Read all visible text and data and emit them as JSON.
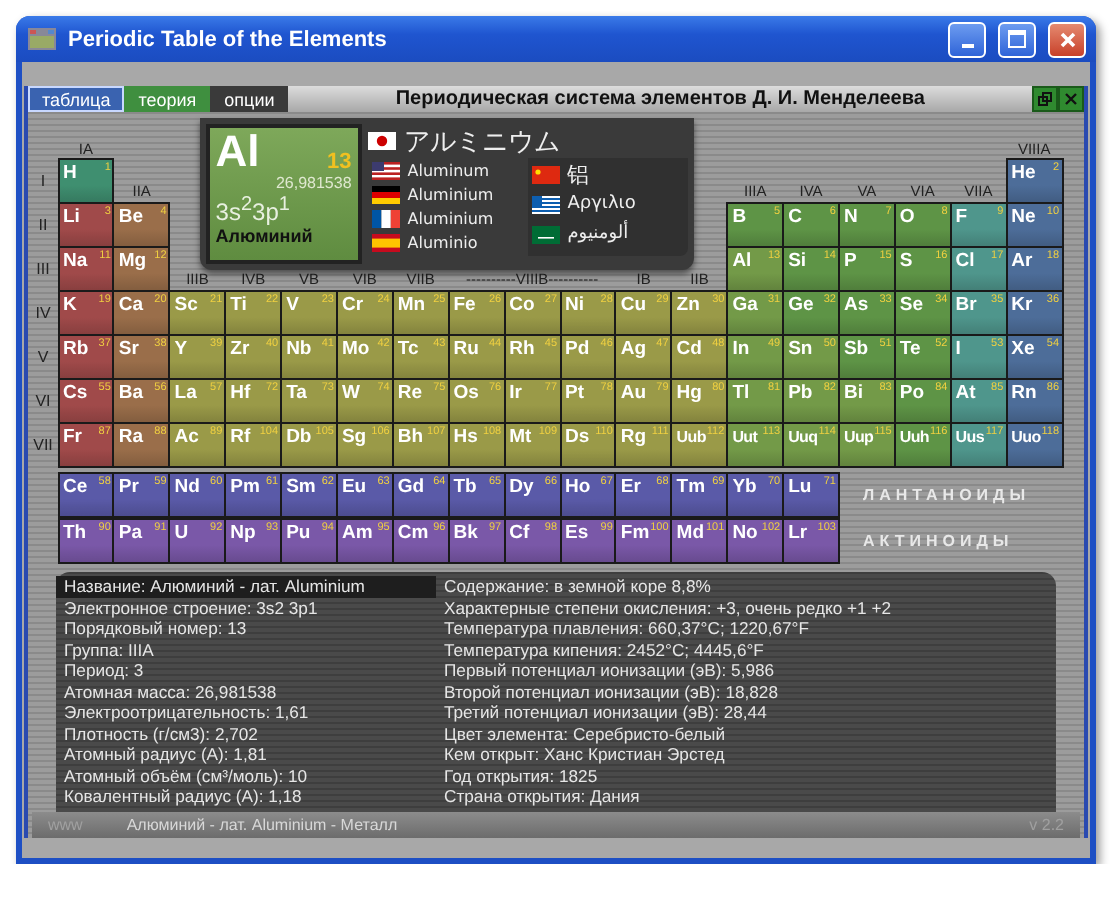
{
  "window": {
    "title": "Periodic Table of the Elements"
  },
  "tabs": [
    {
      "label": "таблица",
      "selected": true,
      "color": "#3a63b0"
    },
    {
      "label": "теория",
      "selected": false,
      "color": "#3f8f3f"
    },
    {
      "label": "опции",
      "selected": false,
      "color": "#3a3a3a"
    }
  ],
  "app_title": "Периодическая система элементов Д. И. Менделеева",
  "group_labels": {
    "top": [
      "IA",
      "VIIIA"
    ],
    "middle": [
      "IIA",
      "IIIA",
      "IVA",
      "VA",
      "VIA",
      "VIIA"
    ],
    "transition": [
      "IIIB",
      "IVB",
      "VB",
      "VIB",
      "VIIB",
      "----------VIIIB----------",
      "IB",
      "IIB"
    ]
  },
  "periods": [
    {
      "label": "I",
      "elements": [
        {
          "symbol": "H",
          "number": "1",
          "color": "#3f8f70"
        },
        {
          "symbol": "He",
          "number": "2",
          "color": "#4d6d99"
        }
      ]
    },
    {
      "label": "II",
      "elements": [
        {
          "symbol": "Li",
          "number": "3",
          "color": "#a04a4a"
        },
        {
          "symbol": "Be",
          "number": "4",
          "color": "#9a6e4a"
        },
        {
          "symbol": "B",
          "number": "5",
          "color": "#5e9446"
        },
        {
          "symbol": "C",
          "number": "6",
          "color": "#5e9446"
        },
        {
          "symbol": "N",
          "number": "7",
          "color": "#5e9446"
        },
        {
          "symbol": "O",
          "number": "8",
          "color": "#5e9446"
        },
        {
          "symbol": "F",
          "number": "9",
          "color": "#4f968c"
        },
        {
          "symbol": "Ne",
          "number": "10",
          "color": "#4d6d99"
        }
      ]
    },
    {
      "label": "III",
      "elements": [
        {
          "symbol": "Na",
          "number": "11",
          "color": "#a04a4a"
        },
        {
          "symbol": "Mg",
          "number": "12",
          "color": "#9a6e4a"
        },
        {
          "symbol": "Al",
          "number": "13",
          "color": "#739a48"
        },
        {
          "symbol": "Si",
          "number": "14",
          "color": "#5e9446"
        },
        {
          "symbol": "P",
          "number": "15",
          "color": "#5e9446"
        },
        {
          "symbol": "S",
          "number": "16",
          "color": "#5e9446"
        },
        {
          "symbol": "Cl",
          "number": "17",
          "color": "#4f968c"
        },
        {
          "symbol": "Ar",
          "number": "18",
          "color": "#4d6d99"
        }
      ]
    },
    {
      "label": "IV",
      "elements": [
        {
          "symbol": "K",
          "number": "19",
          "color": "#a04a4a"
        },
        {
          "symbol": "Ca",
          "number": "20",
          "color": "#9a6e4a"
        },
        {
          "symbol": "Sc",
          "number": "21",
          "color": "#9a9a48"
        },
        {
          "symbol": "Ti",
          "number": "22",
          "color": "#9a9a48"
        },
        {
          "symbol": "V",
          "number": "23",
          "color": "#9a9a48"
        },
        {
          "symbol": "Cr",
          "number": "24",
          "color": "#9a9a48"
        },
        {
          "symbol": "Mn",
          "number": "25",
          "color": "#9a9a48"
        },
        {
          "symbol": "Fe",
          "number": "26",
          "color": "#9a9a48"
        },
        {
          "symbol": "Co",
          "number": "27",
          "color": "#9a9a48"
        },
        {
          "symbol": "Ni",
          "number": "28",
          "color": "#9a9a48"
        },
        {
          "symbol": "Cu",
          "number": "29",
          "color": "#9a9a48"
        },
        {
          "symbol": "Zn",
          "number": "30",
          "color": "#9a9a48"
        },
        {
          "symbol": "Ga",
          "number": "31",
          "color": "#739a48"
        },
        {
          "symbol": "Ge",
          "number": "32",
          "color": "#5e9446"
        },
        {
          "symbol": "As",
          "number": "33",
          "color": "#5e9446"
        },
        {
          "symbol": "Se",
          "number": "34",
          "color": "#5e9446"
        },
        {
          "symbol": "Br",
          "number": "35",
          "color": "#4f968c"
        },
        {
          "symbol": "Kr",
          "number": "36",
          "color": "#4d6d99"
        }
      ]
    },
    {
      "label": "V",
      "elements": [
        {
          "symbol": "Rb",
          "number": "37",
          "color": "#a04a4a"
        },
        {
          "symbol": "Sr",
          "number": "38",
          "color": "#9a6e4a"
        },
        {
          "symbol": "Y",
          "number": "39",
          "color": "#9a9a48"
        },
        {
          "symbol": "Zr",
          "number": "40",
          "color": "#9a9a48"
        },
        {
          "symbol": "Nb",
          "number": "41",
          "color": "#9a9a48"
        },
        {
          "symbol": "Mo",
          "number": "42",
          "color": "#9a9a48"
        },
        {
          "symbol": "Tc",
          "number": "43",
          "color": "#9a9a48"
        },
        {
          "symbol": "Ru",
          "number": "44",
          "color": "#9a9a48"
        },
        {
          "symbol": "Rh",
          "number": "45",
          "color": "#9a9a48"
        },
        {
          "symbol": "Pd",
          "number": "46",
          "color": "#9a9a48"
        },
        {
          "symbol": "Ag",
          "number": "47",
          "color": "#9a9a48"
        },
        {
          "symbol": "Cd",
          "number": "48",
          "color": "#9a9a48"
        },
        {
          "symbol": "In",
          "number": "49",
          "color": "#739a48"
        },
        {
          "symbol": "Sn",
          "number": "50",
          "color": "#739a48"
        },
        {
          "symbol": "Sb",
          "number": "51",
          "color": "#5e9446"
        },
        {
          "symbol": "Te",
          "number": "52",
          "color": "#5e9446"
        },
        {
          "symbol": "I",
          "number": "53",
          "color": "#4f968c"
        },
        {
          "symbol": "Xe",
          "number": "54",
          "color": "#4d6d99"
        }
      ]
    },
    {
      "label": "VI",
      "elements": [
        {
          "symbol": "Cs",
          "number": "55",
          "color": "#a04a4a"
        },
        {
          "symbol": "Ba",
          "number": "56",
          "color": "#9a6e4a"
        },
        {
          "symbol": "La",
          "number": "57",
          "color": "#9a9a48"
        },
        {
          "symbol": "Hf",
          "number": "72",
          "color": "#9a9a48"
        },
        {
          "symbol": "Ta",
          "number": "73",
          "color": "#9a9a48"
        },
        {
          "symbol": "W",
          "number": "74",
          "color": "#9a9a48"
        },
        {
          "symbol": "Re",
          "number": "75",
          "color": "#9a9a48"
        },
        {
          "symbol": "Os",
          "number": "76",
          "color": "#9a9a48"
        },
        {
          "symbol": "Ir",
          "number": "77",
          "color": "#9a9a48"
        },
        {
          "symbol": "Pt",
          "number": "78",
          "color": "#9a9a48"
        },
        {
          "symbol": "Au",
          "number": "79",
          "color": "#9a9a48"
        },
        {
          "symbol": "Hg",
          "number": "80",
          "color": "#9a9a48"
        },
        {
          "symbol": "Tl",
          "number": "81",
          "color": "#739a48"
        },
        {
          "symbol": "Pb",
          "number": "82",
          "color": "#739a48"
        },
        {
          "symbol": "Bi",
          "number": "83",
          "color": "#739a48"
        },
        {
          "symbol": "Po",
          "number": "84",
          "color": "#5e9446"
        },
        {
          "symbol": "At",
          "number": "85",
          "color": "#4f968c"
        },
        {
          "symbol": "Rn",
          "number": "86",
          "color": "#4d6d99"
        }
      ]
    },
    {
      "label": "VII",
      "elements": [
        {
          "symbol": "Fr",
          "number": "87",
          "color": "#a04a4a"
        },
        {
          "symbol": "Ra",
          "number": "88",
          "color": "#9a6e4a"
        },
        {
          "symbol": "Ac",
          "number": "89",
          "color": "#9a9a48"
        },
        {
          "symbol": "Rf",
          "number": "104",
          "color": "#9a9a48"
        },
        {
          "symbol": "Db",
          "number": "105",
          "color": "#9a9a48"
        },
        {
          "symbol": "Sg",
          "number": "106",
          "color": "#9a9a48"
        },
        {
          "symbol": "Bh",
          "number": "107",
          "color": "#9a9a48"
        },
        {
          "symbol": "Hs",
          "number": "108",
          "color": "#9a9a48"
        },
        {
          "symbol": "Mt",
          "number": "109",
          "color": "#9a9a48"
        },
        {
          "symbol": "Ds",
          "number": "110",
          "color": "#9a9a48"
        },
        {
          "symbol": "Rg",
          "number": "111",
          "color": "#9a9a48"
        },
        {
          "symbol": "Uub",
          "number": "112",
          "color": "#9a9a48"
        },
        {
          "symbol": "Uut",
          "number": "113",
          "color": "#739a48"
        },
        {
          "symbol": "Uuq",
          "number": "114",
          "color": "#739a48"
        },
        {
          "symbol": "Uup",
          "number": "115",
          "color": "#739a48"
        },
        {
          "symbol": "Uuh",
          "number": "116",
          "color": "#5e9446"
        },
        {
          "symbol": "Uus",
          "number": "117",
          "color": "#4f968c"
        },
        {
          "symbol": "Uuo",
          "number": "118",
          "color": "#4d6d99"
        }
      ]
    }
  ],
  "series": [
    {
      "label": "ЛАНТАНОИДЫ",
      "elements": [
        {
          "symbol": "Ce",
          "number": "58",
          "color": "#5a5aa8"
        },
        {
          "symbol": "Pr",
          "number": "59",
          "color": "#5a5aa8"
        },
        {
          "symbol": "Nd",
          "number": "60",
          "color": "#5a5aa8"
        },
        {
          "symbol": "Pm",
          "number": "61",
          "color": "#5a5aa8"
        },
        {
          "symbol": "Sm",
          "number": "62",
          "color": "#5a5aa8"
        },
        {
          "symbol": "Eu",
          "number": "63",
          "color": "#5a5aa8"
        },
        {
          "symbol": "Gd",
          "number": "64",
          "color": "#5a5aa8"
        },
        {
          "symbol": "Tb",
          "number": "65",
          "color": "#5a5aa8"
        },
        {
          "symbol": "Dy",
          "number": "66",
          "color": "#5a5aa8"
        },
        {
          "symbol": "Ho",
          "number": "67",
          "color": "#5a5aa8"
        },
        {
          "symbol": "Er",
          "number": "68",
          "color": "#5a5aa8"
        },
        {
          "symbol": "Tm",
          "number": "69",
          "color": "#5a5aa8"
        },
        {
          "symbol": "Yb",
          "number": "70",
          "color": "#5a5aa8"
        },
        {
          "symbol": "Lu",
          "number": "71",
          "color": "#5a5aa8"
        }
      ]
    },
    {
      "label": "АКТИНОИДЫ",
      "elements": [
        {
          "symbol": "Th",
          "number": "90",
          "color": "#7a58a8"
        },
        {
          "symbol": "Pa",
          "number": "91",
          "color": "#7a58a8"
        },
        {
          "symbol": "U",
          "number": "92",
          "color": "#7a58a8"
        },
        {
          "symbol": "Np",
          "number": "93",
          "color": "#7a58a8"
        },
        {
          "symbol": "Pu",
          "number": "94",
          "color": "#7a58a8"
        },
        {
          "symbol": "Am",
          "number": "95",
          "color": "#7a58a8"
        },
        {
          "symbol": "Cm",
          "number": "96",
          "color": "#7a58a8"
        },
        {
          "symbol": "Bk",
          "number": "97",
          "color": "#7a58a8"
        },
        {
          "symbol": "Cf",
          "number": "98",
          "color": "#7a58a8"
        },
        {
          "symbol": "Es",
          "number": "99",
          "color": "#7a58a8"
        },
        {
          "symbol": "Fm",
          "number": "100",
          "color": "#7a58a8"
        },
        {
          "symbol": "Md",
          "number": "101",
          "color": "#7a58a8"
        },
        {
          "symbol": "No",
          "number": "102",
          "color": "#7a58a8"
        },
        {
          "symbol": "Lr",
          "number": "103",
          "color": "#7a58a8"
        }
      ]
    }
  ],
  "selected_element": {
    "symbol": "Al",
    "number": "13",
    "mass": "26,981538",
    "configuration": "3s$^{2}$3p$^{1}$",
    "name": "Алюминий",
    "names": [
      {
        "text": "アルミニウム",
        "kind": "jp"
      },
      {
        "text": "Aluminum",
        "kind": "us"
      },
      {
        "text": "Aluminium",
        "kind": "de"
      },
      {
        "text": "Aluminium",
        "kind": "fr"
      },
      {
        "text": "Aluminio",
        "kind": "es"
      }
    ],
    "names_2": [
      {
        "text": "铝",
        "kind": "cn"
      },
      {
        "text": "Αργιλιο",
        "kind": "gr"
      },
      {
        "text": "ألومنيوم",
        "kind": "sa"
      }
    ]
  },
  "details_left": [
    {
      "text": "Название: Алюминий - лат. Aluminium",
      "selected": true
    },
    {
      "text": "Электронное строение: 3s2 3p1",
      "selected": false
    },
    {
      "text": "Порядковый номер: 13",
      "selected": false
    },
    {
      "text": "Группа: IIIA",
      "selected": false
    },
    {
      "text": "Период: 3",
      "selected": false
    },
    {
      "text": "Атомная масса: 26,981538",
      "selected": false
    },
    {
      "text": "Электроотрицательность: 1,61",
      "selected": false
    },
    {
      "text": "Плотность (г/см3): 2,702",
      "selected": false
    },
    {
      "text": "Атомный радиус (A): 1,81",
      "selected": false
    },
    {
      "text": "Атомный объём (см³/моль): 10",
      "selected": false
    },
    {
      "text": "Ковалентный радиус (A): 1,18",
      "selected": false
    }
  ],
  "details_right": [
    "Содержание: в земной коре 8,8%",
    "Характерные степени окисления: +3, очень редко +1 +2",
    "Температура плавления: 660,37°C;  1220,67°F",
    "Температура кипения: 2452°C;  4445,6°F",
    "Первый потенциал ионизации (эВ): 5,986",
    "Второй потенциал ионизации (эВ): 18,828",
    "Третий потенциал ионизации (эВ): 28,44",
    "Цвет элемента: Серебристо-белый",
    "Кем открыт: Ханс Кристиан Эрстед",
    "Год открытия: 1825",
    "Страна открытия: Дания"
  ],
  "status_bar": {
    "left": "www",
    "text": "Алюминий - лат. Aluminium - Металл",
    "version": "v 2.2"
  }
}
